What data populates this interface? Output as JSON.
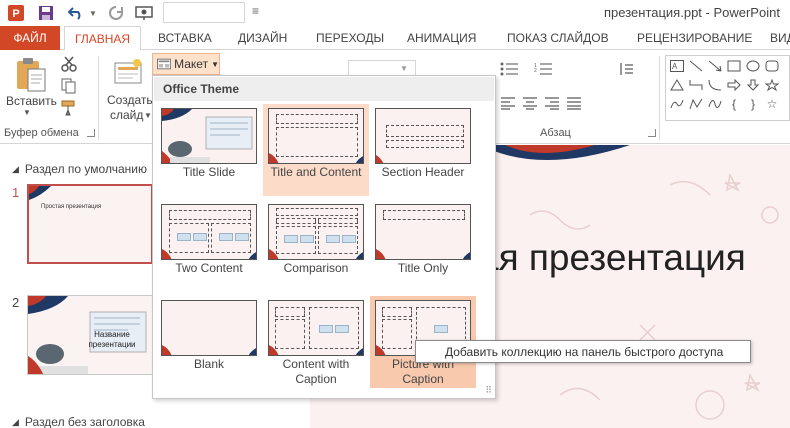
{
  "titlebar": {
    "app_title": "презентация.ppt - PowerPoint",
    "qat_input_value": ""
  },
  "tabs": {
    "file": "ФАЙЛ",
    "home": "ГЛАВНАЯ",
    "insert": "ВСТАВКА",
    "design": "ДИЗАЙН",
    "transitions": "ПЕРЕХОДЫ",
    "animations": "АНИМАЦИЯ",
    "slideshow": "ПОКАЗ СЛАЙДОВ",
    "review": "РЕЦЕНЗИРОВАНИЕ",
    "view": "ВИД"
  },
  "ribbon": {
    "paste_label": "Вставить",
    "new_slide_label_1": "Создать",
    "new_slide_label_2": "слайд",
    "layout_button": "Макет",
    "clipboard_group": "Буфер обмена",
    "paragraph_group": "Абзац"
  },
  "layout_gallery": {
    "header": "Office Theme",
    "items": [
      {
        "label": "Title Slide"
      },
      {
        "label": "Title and Content"
      },
      {
        "label": "Section Header"
      },
      {
        "label": "Two Content"
      },
      {
        "label": "Comparison"
      },
      {
        "label": "Title Only"
      },
      {
        "label": "Blank"
      },
      {
        "label": "Content with Caption"
      },
      {
        "label": "Picture with Caption"
      }
    ]
  },
  "tooltip": "Добавить коллекцию на панель быстрого доступа",
  "thumbnails": {
    "section_1": "Раздел по умолчанию",
    "section_2": "Раздел без заголовка",
    "slides": [
      {
        "number": "1",
        "text": "Простая презентация"
      },
      {
        "number": "2",
        "text": "Название презентации"
      }
    ]
  },
  "slide": {
    "title_visible": "ая презентация"
  },
  "colors": {
    "accent": "#d24726",
    "hover": "#f8c9ad",
    "slide_bg": "#fcf1f1",
    "navy": "#1f3864",
    "red": "#c0392b"
  }
}
